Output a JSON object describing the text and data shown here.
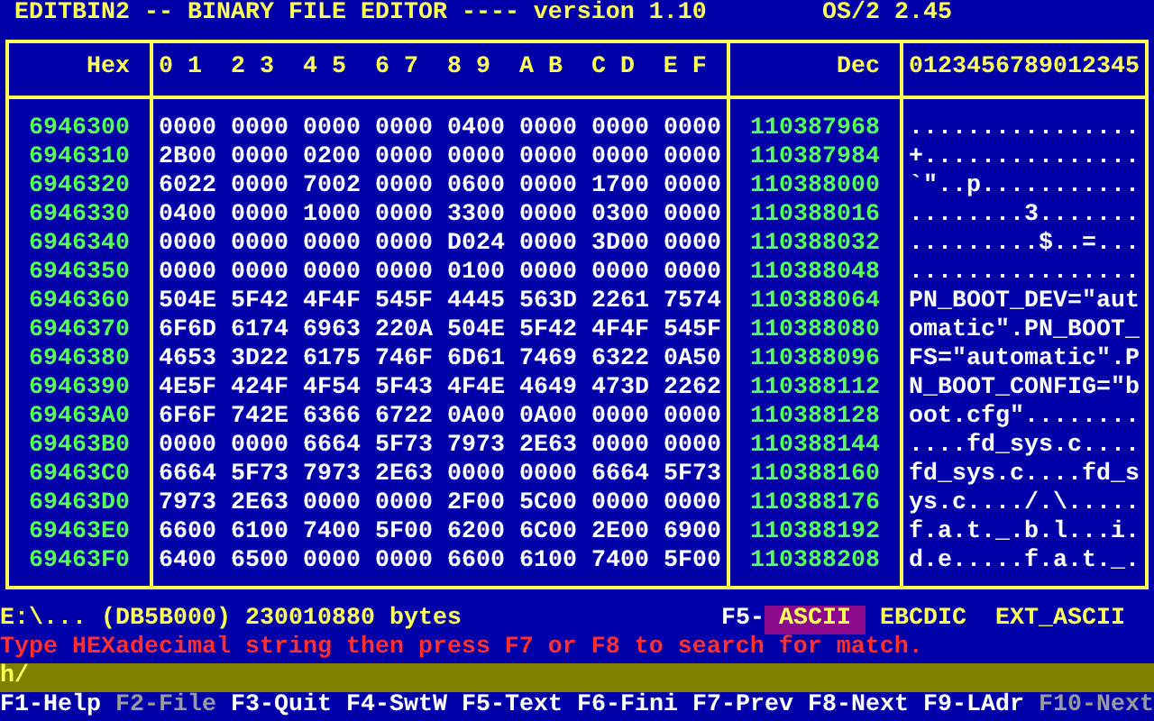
{
  "title": "EDITBIN2 -- BINARY FILE EDITOR ---- version 1.10",
  "system_version": "OS/2 2.45",
  "table": {
    "headers": {
      "address": "Hex",
      "hex": "0 1  2 3  4 5  6 7  8 9  A B  C D  E F",
      "dec": "Dec",
      "ascii": "0123456789012345"
    },
    "rows": [
      {
        "address": "6946300",
        "hex": [
          "0000",
          "0000",
          "0000",
          "0000",
          "0400",
          "0000",
          "0000",
          "0000"
        ],
        "dec": "110387968",
        "ascii": "................"
      },
      {
        "address": "6946310",
        "hex": [
          "2B00",
          "0000",
          "0200",
          "0000",
          "0000",
          "0000",
          "0000",
          "0000"
        ],
        "dec": "110387984",
        "ascii": "+..............."
      },
      {
        "address": "6946320",
        "hex": [
          "6022",
          "0000",
          "7002",
          "0000",
          "0600",
          "0000",
          "1700",
          "0000"
        ],
        "dec": "110388000",
        "ascii": "`\"..p..........."
      },
      {
        "address": "6946330",
        "hex": [
          "0400",
          "0000",
          "1000",
          "0000",
          "3300",
          "0000",
          "0300",
          "0000"
        ],
        "dec": "110388016",
        "ascii": "........3......."
      },
      {
        "address": "6946340",
        "hex": [
          "0000",
          "0000",
          "0000",
          "0000",
          "D024",
          "0000",
          "3D00",
          "0000"
        ],
        "dec": "110388032",
        "ascii": ".........$..=..."
      },
      {
        "address": "6946350",
        "hex": [
          "0000",
          "0000",
          "0000",
          "0000",
          "0100",
          "0000",
          "0000",
          "0000"
        ],
        "dec": "110388048",
        "ascii": "................"
      },
      {
        "address": "6946360",
        "hex": [
          "504E",
          "5F42",
          "4F4F",
          "545F",
          "4445",
          "563D",
          "2261",
          "7574"
        ],
        "dec": "110388064",
        "ascii": "PN_BOOT_DEV=\"aut"
      },
      {
        "address": "6946370",
        "hex": [
          "6F6D",
          "6174",
          "6963",
          "220A",
          "504E",
          "5F42",
          "4F4F",
          "545F"
        ],
        "dec": "110388080",
        "ascii": "omatic\".PN_BOOT_"
      },
      {
        "address": "6946380",
        "hex": [
          "4653",
          "3D22",
          "6175",
          "746F",
          "6D61",
          "7469",
          "6322",
          "0A50"
        ],
        "dec": "110388096",
        "ascii": "FS=\"automatic\".P"
      },
      {
        "address": "6946390",
        "hex": [
          "4E5F",
          "424F",
          "4F54",
          "5F43",
          "4F4E",
          "4649",
          "473D",
          "2262"
        ],
        "dec": "110388112",
        "ascii": "N_BOOT_CONFIG=\"b"
      },
      {
        "address": "69463A0",
        "hex": [
          "6F6F",
          "742E",
          "6366",
          "6722",
          "0A00",
          "0A00",
          "0000",
          "0000"
        ],
        "dec": "110388128",
        "ascii": "oot.cfg\"........"
      },
      {
        "address": "69463B0",
        "hex": [
          "0000",
          "0000",
          "6664",
          "5F73",
          "7973",
          "2E63",
          "0000",
          "0000"
        ],
        "dec": "110388144",
        "ascii": "....fd_sys.c...."
      },
      {
        "address": "69463C0",
        "hex": [
          "6664",
          "5F73",
          "7973",
          "2E63",
          "0000",
          "0000",
          "6664",
          "5F73"
        ],
        "dec": "110388160",
        "ascii": "fd_sys.c....fd_s"
      },
      {
        "address": "69463D0",
        "hex": [
          "7973",
          "2E63",
          "0000",
          "0000",
          "2F00",
          "5C00",
          "0000",
          "0000"
        ],
        "dec": "110388176",
        "ascii": "ys.c..../.\\....."
      },
      {
        "address": "69463E0",
        "hex": [
          "6600",
          "6100",
          "7400",
          "5F00",
          "6200",
          "6C00",
          "2E00",
          "6900"
        ],
        "dec": "110388192",
        "ascii": "f.a.t._.b.l...i."
      },
      {
        "address": "69463F0",
        "hex": [
          "6400",
          "6500",
          "0000",
          "0000",
          "6600",
          "6100",
          "7400",
          "5F00"
        ],
        "dec": "110388208",
        "ascii": "d.e.....f.a.t._."
      }
    ]
  },
  "status": {
    "file_info": "E:\\... (DB5B000) 230010880 bytes",
    "mode_key": "F5-",
    "modes": [
      {
        "label": "ASCII",
        "selected": true
      },
      {
        "label": "EBCDIC",
        "selected": false
      },
      {
        "label": "EXT_ASCII",
        "selected": false
      }
    ]
  },
  "message": "Type HEXadecimal string then press F7 or F8 to search for match.",
  "input": {
    "value": "h/"
  },
  "function_keys": [
    {
      "label": "F1-Help",
      "disabled": false
    },
    {
      "label": "F2-File",
      "disabled": true
    },
    {
      "label": "F3-Quit",
      "disabled": false
    },
    {
      "label": "F4-SwtW",
      "disabled": false
    },
    {
      "label": "F5-Text",
      "disabled": false
    },
    {
      "label": "F6-Fini",
      "disabled": false
    },
    {
      "label": "F7-Prev",
      "disabled": false
    },
    {
      "label": "F8-Next",
      "disabled": false
    },
    {
      "label": "F9-LAdr",
      "disabled": false
    },
    {
      "label": "F10-Next",
      "disabled": true
    }
  ]
}
